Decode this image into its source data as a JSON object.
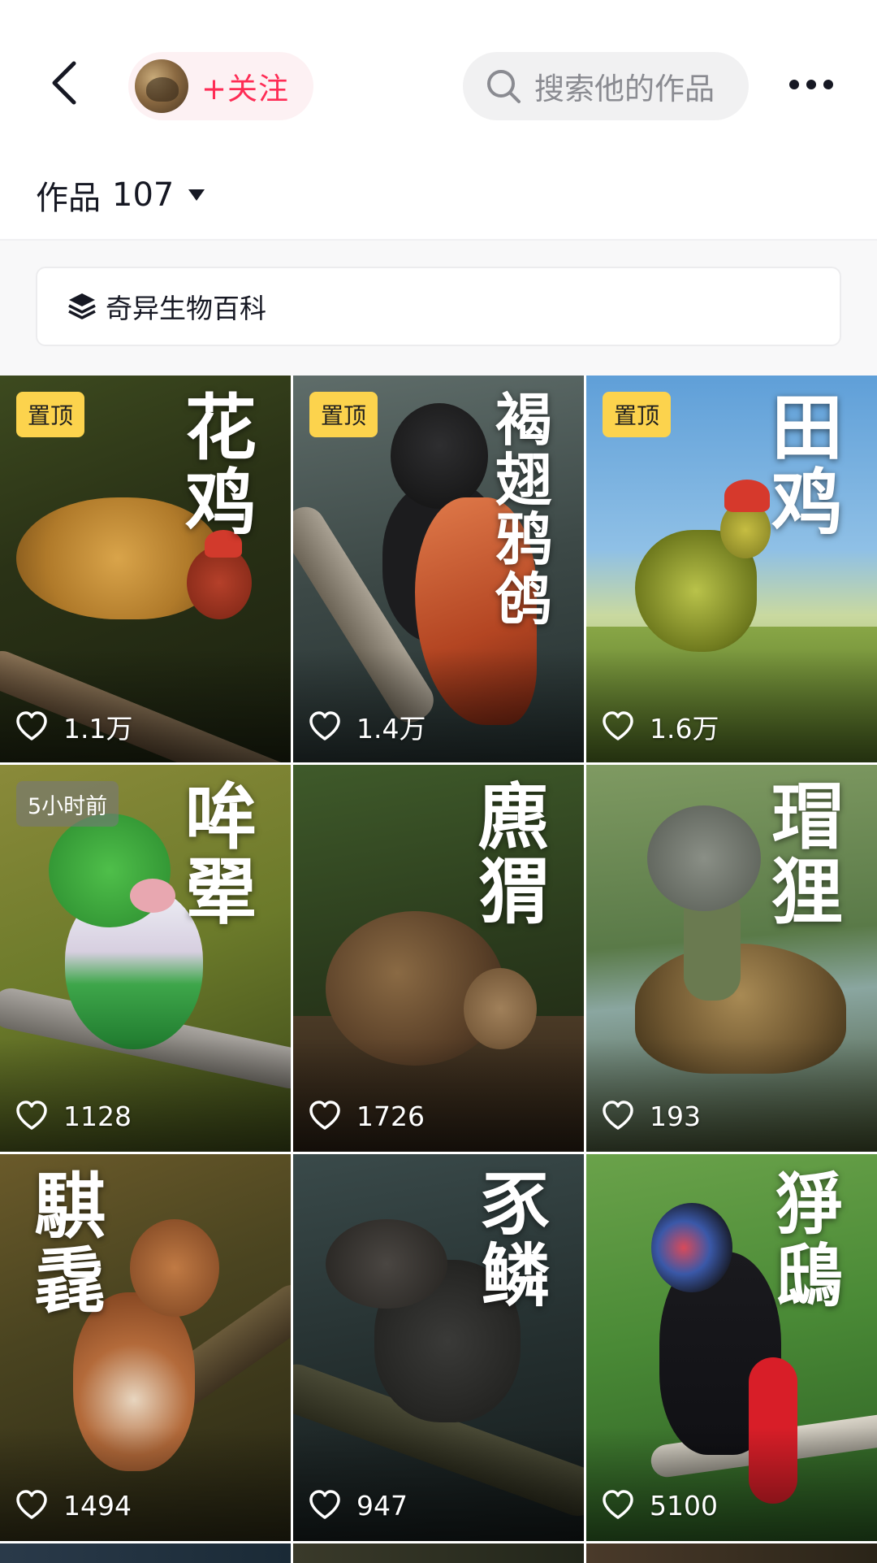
{
  "header": {
    "follow_label": "+关注",
    "search_placeholder": "搜索他的作品"
  },
  "works": {
    "label": "作品",
    "count": "107"
  },
  "collection": {
    "label": "奇异生物百科"
  },
  "colors": {
    "accent": "#fe2c55",
    "pin": "#fcd34d"
  },
  "posts": [
    {
      "title": "花鸡",
      "badge": "置顶",
      "likes": "1.1万"
    },
    {
      "title": "褐翅鸦鸧",
      "badge": "置顶",
      "likes": "1.4万"
    },
    {
      "title": "田鸡",
      "badge": "置顶",
      "likes": "1.6万"
    },
    {
      "title": "哞翚",
      "badge": "5小时前",
      "likes": "1128"
    },
    {
      "title": "麃猬",
      "badge": "",
      "likes": "1726"
    },
    {
      "title": "瑁狸",
      "badge": "",
      "likes": "193"
    },
    {
      "title": "騏毳",
      "badge": "",
      "likes": "1494"
    },
    {
      "title": "豕鳞",
      "badge": "",
      "likes": "947"
    },
    {
      "title": "猙鴟",
      "badge": "",
      "likes": "5100"
    }
  ]
}
